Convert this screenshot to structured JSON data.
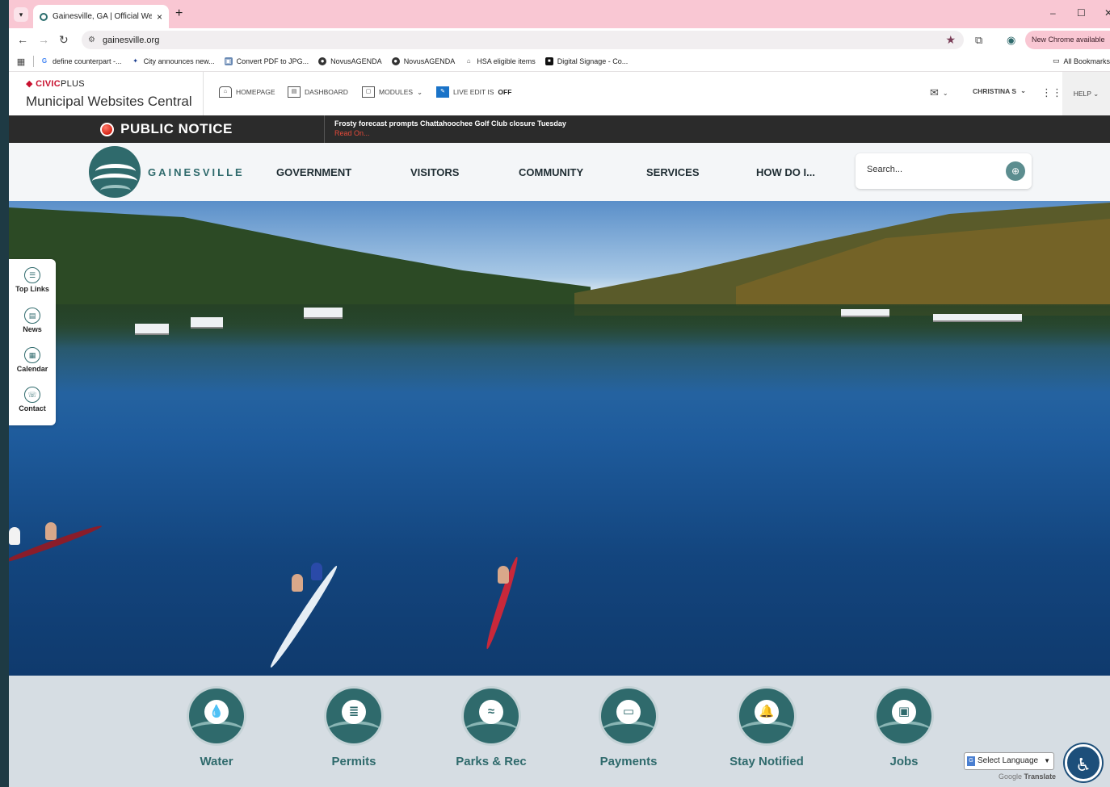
{
  "browser": {
    "tab_title": "Gainesville, GA | Official Website",
    "new_tab": "+",
    "url": "gainesville.org",
    "update_label": "New Chrome available",
    "window_controls": {
      "minimize": "–",
      "maximize": "☐",
      "close": "✕"
    },
    "bookmarks": [
      {
        "label": "define counterpart -...",
        "icon": "google-icon"
      },
      {
        "label": "City announces new...",
        "icon": "running-person-icon"
      },
      {
        "label": "Convert PDF to JPG...",
        "icon": "pdf-converter-icon"
      },
      {
        "label": "NovusAGENDA",
        "icon": "globe-icon"
      },
      {
        "label": "NovusAGENDA",
        "icon": "globe-icon"
      },
      {
        "label": "HSA eligible items",
        "icon": "shopping-icon"
      },
      {
        "label": "Digital Signage - Co...",
        "icon": "signage-icon"
      }
    ],
    "all_bookmarks": "All Bookmarks"
  },
  "admin": {
    "brand_civic": "CIVIC",
    "brand_plus": "PLUS",
    "subtitle": "Municipal Websites Central",
    "homepage": "Homepage",
    "dashboard": "Dashboard",
    "modules": "Modules",
    "live_edit": "Live Edit is",
    "live_edit_state": "OFF",
    "user": "CHRISTINA S",
    "help": "HELP"
  },
  "notice": {
    "label": "PUBLIC NOTICE",
    "headline": "Frosty forecast prompts Chattahoochee Golf Club closure Tuesday",
    "read_on": "Read On..."
  },
  "site": {
    "logo_text": "GAINESVILLE",
    "nav": [
      "GOVERNMENT",
      "VISITORS",
      "COMMUNITY",
      "SERVICES",
      "HOW DO I..."
    ],
    "search_placeholder": "Search..."
  },
  "sidebar": [
    {
      "label": "Top Links",
      "icon": "list-icon"
    },
    {
      "label": "News",
      "icon": "news-icon"
    },
    {
      "label": "Calendar",
      "icon": "calendar-icon"
    },
    {
      "label": "Contact",
      "icon": "chat-icon"
    }
  ],
  "quick_links": [
    {
      "label": "Water",
      "icon": "water-drop-icon"
    },
    {
      "label": "Permits",
      "icon": "document-icon"
    },
    {
      "label": "Parks & Rec",
      "icon": "swimmer-icon"
    },
    {
      "label": "Payments",
      "icon": "credit-card-icon"
    },
    {
      "label": "Stay Notified",
      "icon": "bell-icon"
    },
    {
      "label": "Jobs",
      "icon": "briefcase-icon"
    }
  ],
  "translate": {
    "select_language": "Select Language",
    "powered_google": "Google",
    "powered_translate": "Translate"
  },
  "colors": {
    "brand_teal": "#2f6a6c",
    "chrome_pink": "#f9c7d3",
    "notice_red": "#d52012"
  }
}
